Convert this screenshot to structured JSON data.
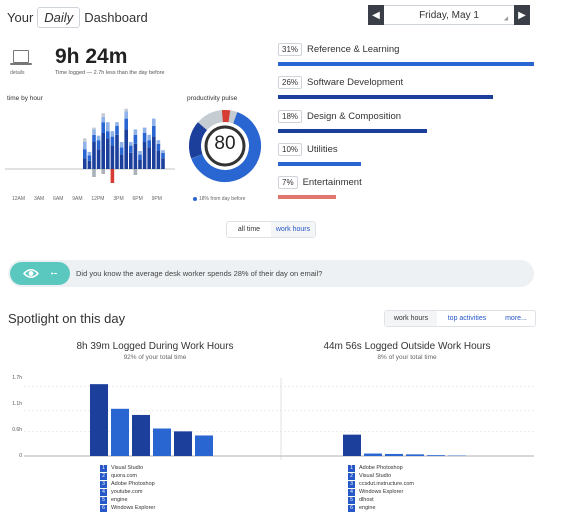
{
  "header": {
    "prefix": "Your",
    "period": "Daily",
    "suffix": "Dashboard",
    "date": "Friday, May 1",
    "prev_icon": "chevron-left-icon",
    "next_icon": "chevron-right-icon"
  },
  "summary": {
    "details_label": "details",
    "time_logged": "9h 24m",
    "subtext": "Time logged — 2.7h less than the day before"
  },
  "time_by_hour": {
    "label": "time by hour",
    "ticks": [
      "12AM",
      "3AM",
      "6AM",
      "9AM",
      "12PM",
      "3PM",
      "6PM",
      "9PM"
    ]
  },
  "pulse": {
    "label": "productivity pulse",
    "score": "80",
    "caption": "18% from day before"
  },
  "categories": [
    {
      "pct": "31%",
      "name": "Reference & Learning",
      "fraction": 0.31,
      "color": "#2a66d1"
    },
    {
      "pct": "26%",
      "name": "Software Development",
      "fraction": 0.26,
      "color": "#1c3f9c"
    },
    {
      "pct": "18%",
      "name": "Design & Composition",
      "fraction": 0.18,
      "color": "#1c3f9c"
    },
    {
      "pct": "10%",
      "name": "Utilities",
      "fraction": 0.1,
      "color": "#2a66d1"
    },
    {
      "pct": "7%",
      "name": "Entertainment",
      "fraction": 0.07,
      "color": "#e0766e"
    }
  ],
  "toggle": {
    "all_time": "all time",
    "work_hours": "work hours"
  },
  "tip": "Did you know the average desk worker spends 28% of their day on email?",
  "spotlight": {
    "title": "Spotlight on this day",
    "tabs": [
      "work hours",
      "top activities",
      "more..."
    ]
  },
  "chart_data": [
    {
      "type": "bar",
      "title": "8h 39m Logged During Work Hours",
      "subtitle": "92% of your total time",
      "categories": [
        "Visual Studio",
        "quora.com",
        "Adobe Photoshop",
        "youtube.com",
        "engine",
        "Windows Explorer"
      ],
      "values": [
        1.75,
        1.15,
        1.0,
        0.67,
        0.6,
        0.5
      ],
      "yticks": [
        "1.7h",
        "1.1h",
        "0.6h",
        "0"
      ],
      "ylim": [
        0,
        1.9
      ]
    },
    {
      "type": "bar",
      "title": "44m 56s Logged Outside Work Hours",
      "subtitle": "8% of your total time",
      "categories": [
        "Adobe Photoshop",
        "Visual Studio",
        "ccsdut.instructure.com",
        "Windows Explorer",
        "dlhost",
        "engine"
      ],
      "values": [
        0.52,
        0.06,
        0.05,
        0.04,
        0.02,
        0.01
      ],
      "ylim": [
        0,
        1.9
      ]
    }
  ]
}
